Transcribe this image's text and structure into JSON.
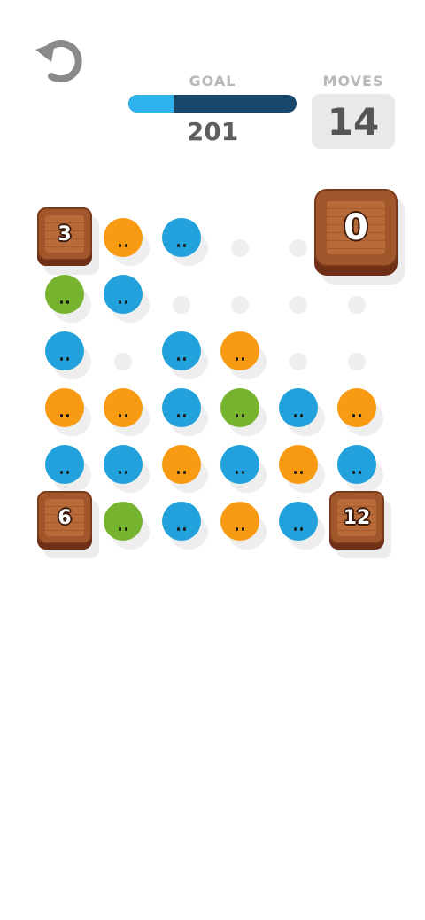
{
  "header": {
    "undo_icon": "undo-arrow-icon",
    "goal_label": "GOAL",
    "goal_value": "201",
    "goal_progress": 0.27,
    "moves_label": "MOVES",
    "moves_value": "14"
  },
  "colors": {
    "blue": "#22a1dd",
    "orange": "#f99a13",
    "green": "#76b42f",
    "progress_fill": "#2fb3ec",
    "progress_track": "#17486b",
    "crate": "#a2562c"
  },
  "board": {
    "rows": 6,
    "cols": 6,
    "cells": [
      [
        "crate",
        "orange",
        "blue",
        "empty",
        "empty",
        "crate"
      ],
      [
        "green",
        "blue",
        "empty",
        "empty",
        "empty",
        "empty"
      ],
      [
        "blue",
        "empty",
        "blue",
        "orange",
        "empty",
        "empty"
      ],
      [
        "orange",
        "orange",
        "blue",
        "green",
        "blue",
        "orange"
      ],
      [
        "blue",
        "blue",
        "orange",
        "blue",
        "orange",
        "blue"
      ],
      [
        "crate",
        "green",
        "blue",
        "orange",
        "blue",
        "crate"
      ]
    ],
    "crates": [
      {
        "row": 0,
        "col": 0,
        "value": "3"
      },
      {
        "row": 0,
        "col": 5,
        "value": "0",
        "large": true
      },
      {
        "row": 5,
        "col": 0,
        "value": "6"
      },
      {
        "row": 5,
        "col": 5,
        "value": "12"
      }
    ]
  }
}
